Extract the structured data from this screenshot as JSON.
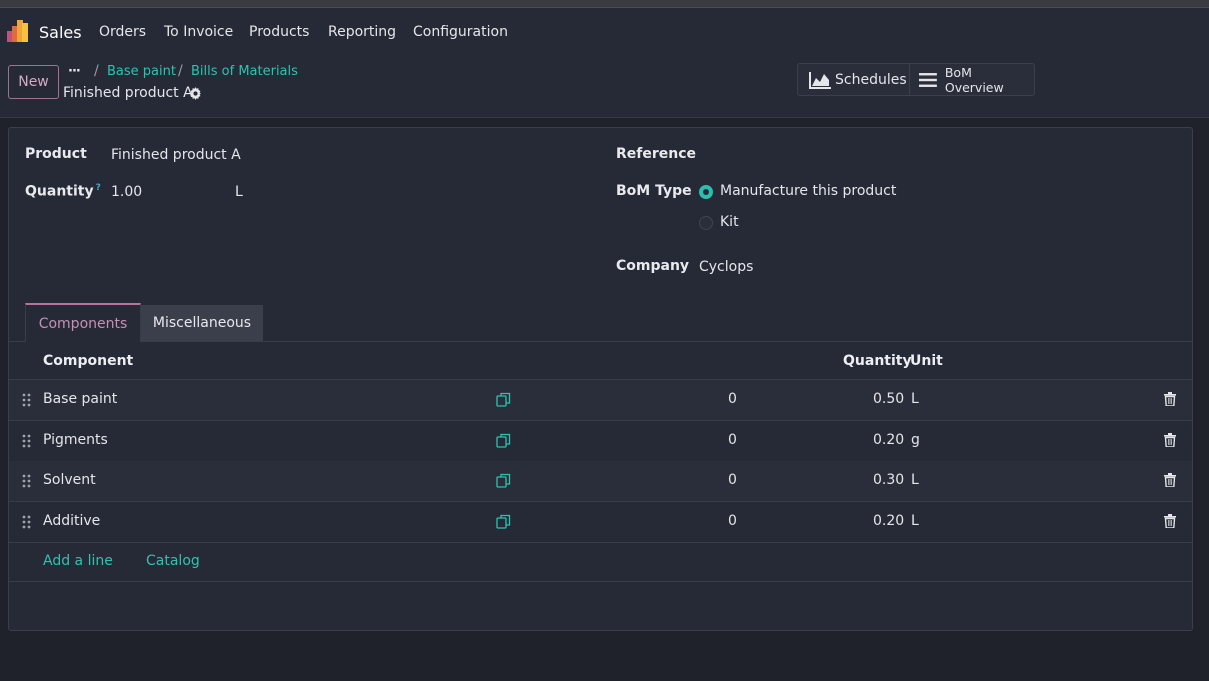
{
  "navbar": {
    "app_name": "Sales",
    "menu": [
      "Orders",
      "To Invoice",
      "Products",
      "Reporting",
      "Configuration"
    ]
  },
  "control_panel": {
    "new_label": "New",
    "more_label": "···",
    "breadcrumbs": [
      "Base paint",
      "Bills of Materials"
    ],
    "record_name": "Finished product A",
    "schedules_label": "Schedules",
    "bom_overview_label": "BoM Overview"
  },
  "form": {
    "product_label": "Product",
    "product_value": "Finished product A",
    "quantity_label": "Quantity",
    "quantity_help": "?",
    "quantity_value": "1.00",
    "quantity_unit": "L",
    "reference_label": "Reference",
    "bom_type_label": "BoM Type",
    "bom_type_options": [
      {
        "label": "Manufacture this product",
        "selected": true
      },
      {
        "label": "Kit",
        "selected": false
      }
    ],
    "company_label": "Company",
    "company_value": "Cyclops"
  },
  "tabs": [
    "Components",
    "Miscellaneous"
  ],
  "table": {
    "headers": {
      "component": "Component",
      "quantity": "Quantity",
      "unit": "Unit"
    },
    "rows": [
      {
        "component": "Base paint",
        "extra": "0",
        "quantity": "0.50",
        "unit": "L"
      },
      {
        "component": "Pigments",
        "extra": "0",
        "quantity": "0.20",
        "unit": "g"
      },
      {
        "component": "Solvent",
        "extra": "0",
        "quantity": "0.30",
        "unit": "L"
      },
      {
        "component": "Additive",
        "extra": "0",
        "quantity": "0.20",
        "unit": "L"
      }
    ],
    "add_line_label": "Add a line",
    "catalog_label": "Catalog"
  },
  "colors": {
    "accent_teal": "#2fc2b0",
    "accent_pink": "#b5739d",
    "background": "#1f212b",
    "panel": "#262a36"
  }
}
